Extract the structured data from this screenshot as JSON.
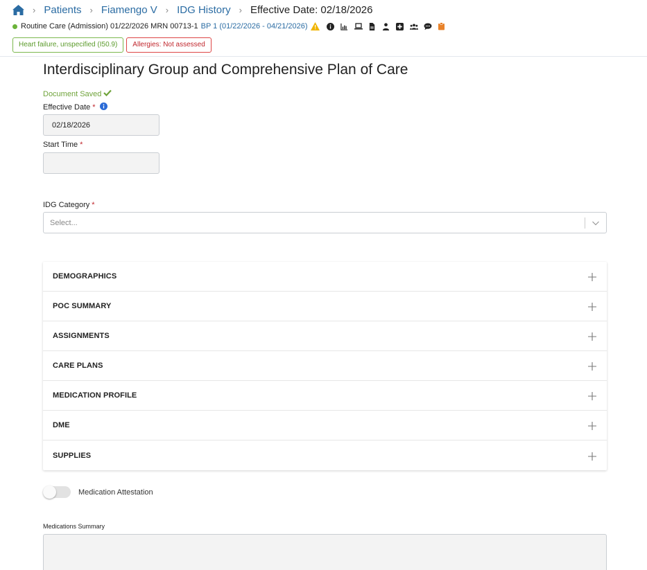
{
  "breadcrumb": {
    "items": [
      "Patients",
      "Fiamengo V",
      "IDG History"
    ],
    "current": "Effective Date: 02/18/2026"
  },
  "patient": {
    "care": "Routine Care",
    "admission": "(Admission)",
    "date": "01/22/2026",
    "mrn": "MRN 00713-1",
    "bp": "BP 1 (01/22/2026 - 04/21/2026)"
  },
  "tags": {
    "diagnosis": "Heart failure, unspecified (I50.9)",
    "allergies": "Allergies: Not assessed"
  },
  "form": {
    "title": "Interdisciplinary Group and Comprehensive Plan of Care",
    "saved": "Document Saved",
    "effective_date_label": "Effective Date",
    "effective_date_value": "02/18/2026",
    "start_time_label": "Start Time",
    "start_time_value": "",
    "required": "*",
    "idg_category_label": "IDG Category",
    "idg_category_placeholder": "Select..."
  },
  "sections": [
    {
      "title": "DEMOGRAPHICS"
    },
    {
      "title": "POC SUMMARY"
    },
    {
      "title": "ASSIGNMENTS"
    },
    {
      "title": "CARE PLANS"
    },
    {
      "title": "MEDICATION PROFILE"
    },
    {
      "title": "DME"
    },
    {
      "title": "SUPPLIES"
    }
  ],
  "attestation": {
    "label": "Medication Attestation",
    "checked": false
  },
  "meds_summary": {
    "label": "Medications Summary",
    "value": ""
  },
  "colors": {
    "link": "#2b6ca3",
    "status_green": "#6bb33a",
    "required_red": "#c0272d",
    "warning": "#f0b400",
    "clipboard": "#e8822a"
  }
}
